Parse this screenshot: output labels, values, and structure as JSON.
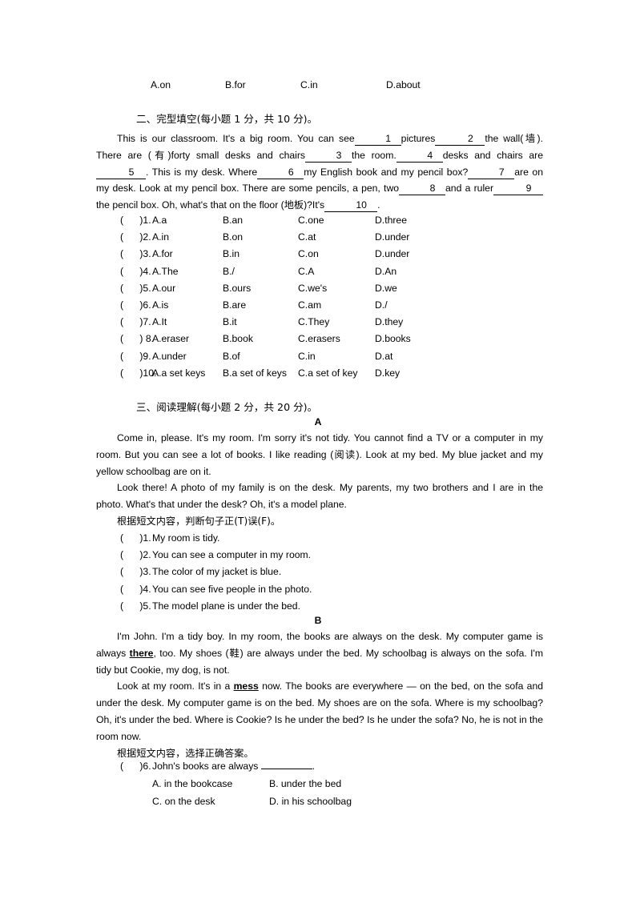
{
  "top_choices": {
    "a": "A.on",
    "b": "B.for",
    "c": "C.in",
    "d": "D.about"
  },
  "section_two": {
    "heading": "二、完型填空(每小题 1 分，共 10 分)。",
    "passage": {
      "l1_a": "This is our classroom. It's a big room. You can see",
      "l1_b1": "1",
      "l1_b": "pictures",
      "l1_b2": "2",
      "l1_c": "the wall(墙).",
      "l2_a": "There are (有)forty small desks and chairs",
      "l2_b1": "3",
      "l2_b": "the room.",
      "l2_b2": "4",
      "l2_c": "desks and chairs are",
      "l2_b3": "5",
      "l2_d": ".",
      "l3_a": "This is my desk. Where",
      "l3_b1": "6",
      "l3_b": "my English book and my pencil box?",
      "l3_b2": "7",
      "l3_c": "are on my desk. Look",
      "l4_a": "at my pencil box. There are some pencils, a pen, two",
      "l4_b1": "8",
      "l4_b": "and a ruler",
      "l4_b2": "9",
      "l4_c": "the pencil box.",
      "l5_a": "Oh, what's that on the floor    (地板)?It's",
      "l5_b1": "10",
      "l5_c": "."
    },
    "options": [
      {
        "paren": "(      )1.",
        "a": "A.a",
        "b": "B.an",
        "c": "C.one",
        "d": "D.three"
      },
      {
        "paren": "(      )2.",
        "a": "A.in",
        "b": "B.on",
        "c": "C.at",
        "d": "D.under"
      },
      {
        "paren": "(      )3.",
        "a": "A.for",
        "b": "B.in",
        "c": "C.on",
        "d": "D.under"
      },
      {
        "paren": "(      )4.",
        "a": "A.The",
        "b": "B./",
        "c": "C.A",
        "d": "D.An"
      },
      {
        "paren": "(      )5.",
        "a": "A.our",
        "b": "B.ours",
        "c": "C.we's",
        "d": "D.we"
      },
      {
        "paren": "(      )6.",
        "a": "A.is",
        "b": "B.are",
        "c": "C.am",
        "d": "D./"
      },
      {
        "paren": "(      )7.",
        "a": "A.It",
        "b": "B.it",
        "c": "C.They",
        "d": "D.they"
      },
      {
        "paren": "(      ) 8.",
        "a": "A.eraser",
        "b": "B.book",
        "c": "C.erasers",
        "d": "D.books"
      },
      {
        "paren": "(      )9.",
        "a": "A.under",
        "b": "B.of",
        "c": "C.in",
        "d": "D.at"
      },
      {
        "paren": "(      )10.",
        "a": "A.a set keys",
        "b": "B.a set of keys",
        "c": "C.a set of key",
        "d": "D.key"
      }
    ]
  },
  "section_three": {
    "heading": "三、阅读理解(每小题 2 分，共 20 分)。",
    "passage_a": {
      "label": "A",
      "p1": "Come in, please. It's my room. I'm sorry it's not tidy. You cannot find a TV or a computer in my room. But you can see a lot of books. I like reading (阅读). Look at my bed. My blue jacket and my yellow schoolbag are on it.",
      "p2": "Look there! A photo of my family is on the desk. My parents, my two brothers and I are in the photo. What's that under the desk? Oh, it's a model plane.",
      "instruction": "根据短文内容，判断句子正(T)误(F)。",
      "statements": [
        {
          "paren": "(      )1.",
          "text": "My room is tidy."
        },
        {
          "paren": "(      )2.",
          "text": "You can see a computer in my room."
        },
        {
          "paren": "(      )3.",
          "text": "The color of my jacket is blue."
        },
        {
          "paren": "(      )4.",
          "text": "You can see five people in the photo."
        },
        {
          "paren": "(      )5.",
          "text": "The model plane is under the bed."
        }
      ]
    },
    "passage_b": {
      "label": "B",
      "p1_a": "I'm John. I'm a tidy boy. In my room, the books are always on the desk. My computer game is always ",
      "p1_bold": "there",
      "p1_b": ", too. My shoes (鞋) are always under the bed. My schoolbag is always on the sofa. I'm tidy but Cookie, my dog, is not.",
      "p2_a": "Look at my room. It's in a ",
      "p2_bold": "mess",
      "p2_b": " now. The books are everywhere — on the bed, on the sofa and under the desk. My computer game is on the bed. My shoes are on the sofa. Where is my schoolbag? Oh, it's under the bed. Where is Cookie? Is he under the bed? Is he under the sofa? No, he is not in the room now.",
      "instruction": "根据短文内容，选择正确答案。",
      "question": {
        "paren": "(      )6.",
        "stem_a": "John's books are always ",
        "stem_b": ".",
        "choice_a": "A. in the bookcase",
        "choice_b": "B. under the bed",
        "choice_c": "C. on the desk",
        "choice_d": "D. in his schoolbag"
      }
    }
  }
}
